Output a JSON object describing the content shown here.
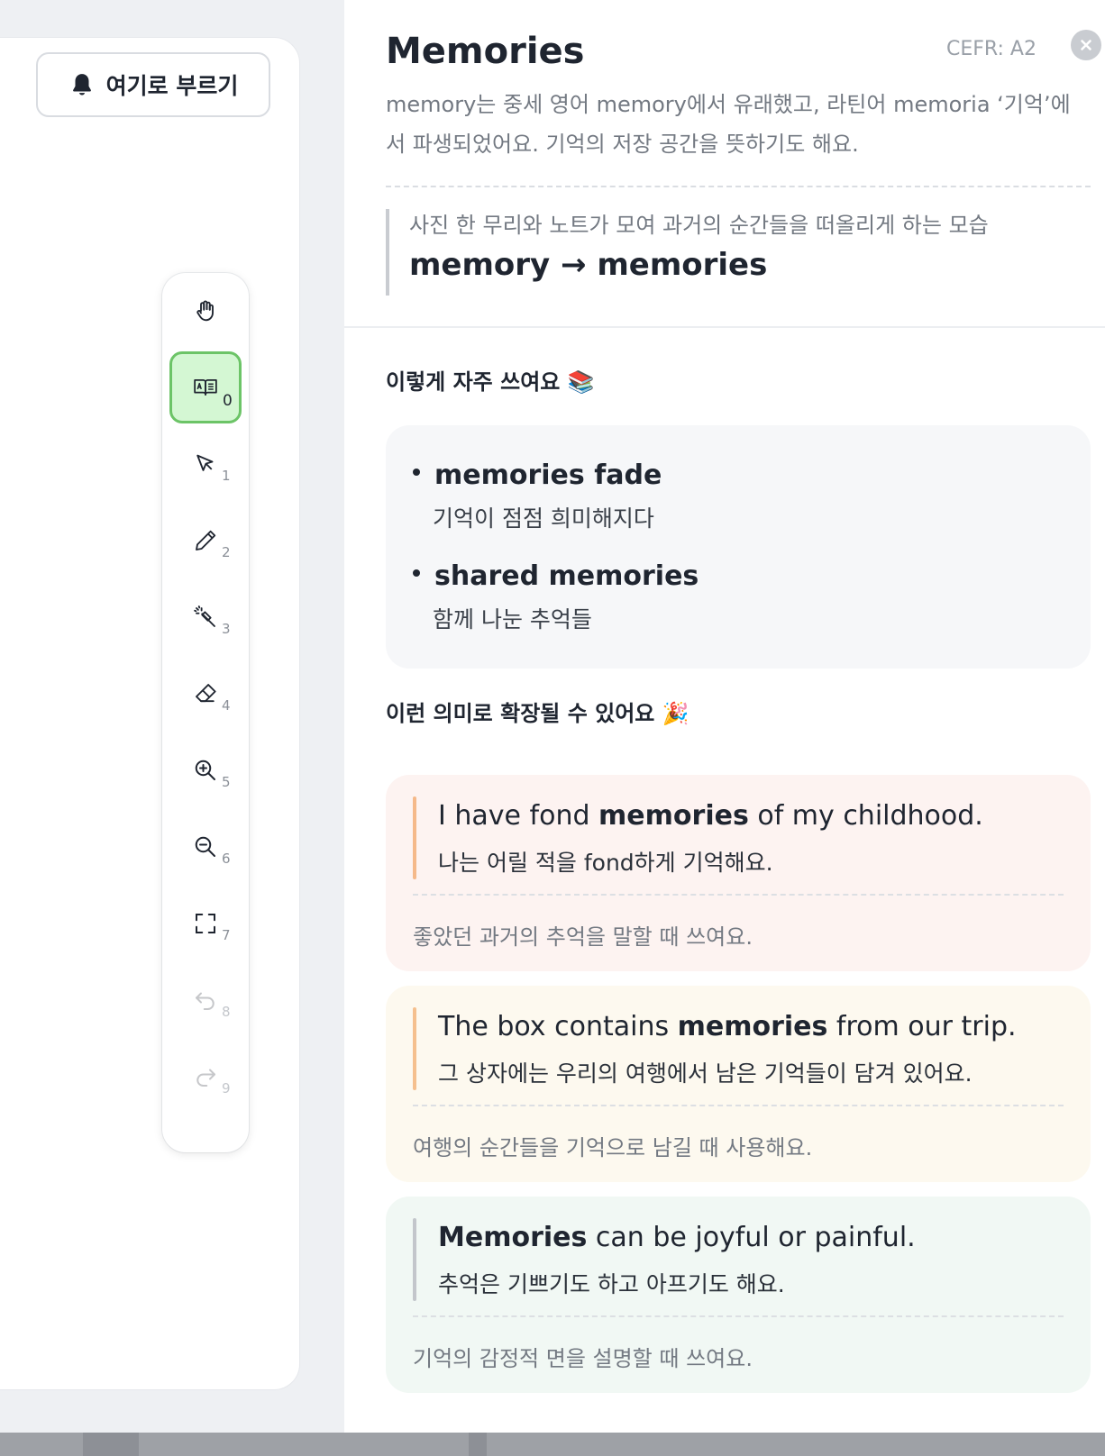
{
  "call_button": {
    "label": "여기로 부르기",
    "icon": "bell-icon"
  },
  "toolbar": {
    "tools": [
      {
        "name": "hand-tool",
        "icon": "hand-icon",
        "shortcut": ""
      },
      {
        "name": "dictionary-tool",
        "icon": "dictionary-icon",
        "shortcut": "0",
        "active": true
      },
      {
        "name": "select-tool",
        "icon": "cursor-icon",
        "shortcut": "1"
      },
      {
        "name": "pen-tool",
        "icon": "pencil-icon",
        "shortcut": "2"
      },
      {
        "name": "magic-pen-tool",
        "icon": "magic-wand-icon",
        "shortcut": "3"
      },
      {
        "name": "eraser-tool",
        "icon": "eraser-icon",
        "shortcut": "4"
      },
      {
        "name": "zoom-in-tool",
        "icon": "zoom-in-icon",
        "shortcut": "5"
      },
      {
        "name": "zoom-out-tool",
        "icon": "zoom-out-icon",
        "shortcut": "6"
      },
      {
        "name": "fit-screen-tool",
        "icon": "fullscreen-icon",
        "shortcut": "7"
      },
      {
        "name": "undo-tool",
        "icon": "undo-icon",
        "shortcut": "8",
        "disabled": true
      },
      {
        "name": "redo-tool",
        "icon": "redo-icon",
        "shortcut": "9",
        "disabled": true
      }
    ]
  },
  "word": {
    "title": "Memories",
    "cefr": "CEFR: A2",
    "etymology": "memory는 중세 영어 memory에서 유래했고, 라틴어 memoria ‘기억’에서 파생되었어요. 기억의 저장 공간을 뜻하기도 해요.",
    "image_caption": "사진 한 무리와 노트가 모여 과거의 순간들을 떠올리게 하는 모습",
    "form_change": "memory → memories"
  },
  "collocations": {
    "title": "이렇게 자주 쓰여요 📚",
    "items": [
      {
        "phrase": "memories fade",
        "meaning": "기억이 점점 희미해지다"
      },
      {
        "phrase": "shared memories",
        "meaning": "함께 나눈 추억들"
      }
    ]
  },
  "extensions": {
    "title": "이런 의미로 확장될 수 있어요 🎉",
    "examples": [
      {
        "before": "I have fond ",
        "keyword": "memories",
        "after": " of my childhood.",
        "translation": "나는 어릴 적을 fond하게 기억해요.",
        "usage": "좋았던 과거의 추억을 말할 때 쓰여요.",
        "bg_color": "#fdf3f1",
        "bar_color": "#f5b98a"
      },
      {
        "before": "The box contains ",
        "keyword": "memories",
        "after": " from our trip.",
        "translation": "그 상자에는 우리의 여행에서 남은 기억들이 담겨 있어요.",
        "usage": "여행의 순간들을 기억으로 남길 때 사용해요.",
        "bg_color": "#fdf9ef",
        "bar_color": "#f5c08e"
      },
      {
        "before": "",
        "keyword": "Memories",
        "after": " can be joyful or painful.",
        "translation": "추억은 기쁘기도 하고 아프기도 해요.",
        "usage": "기억의 감정적 면을 설명할 때 쓰여요.",
        "bg_color": "#f1f8f4",
        "bar_color": "#c3c6cb"
      }
    ]
  }
}
